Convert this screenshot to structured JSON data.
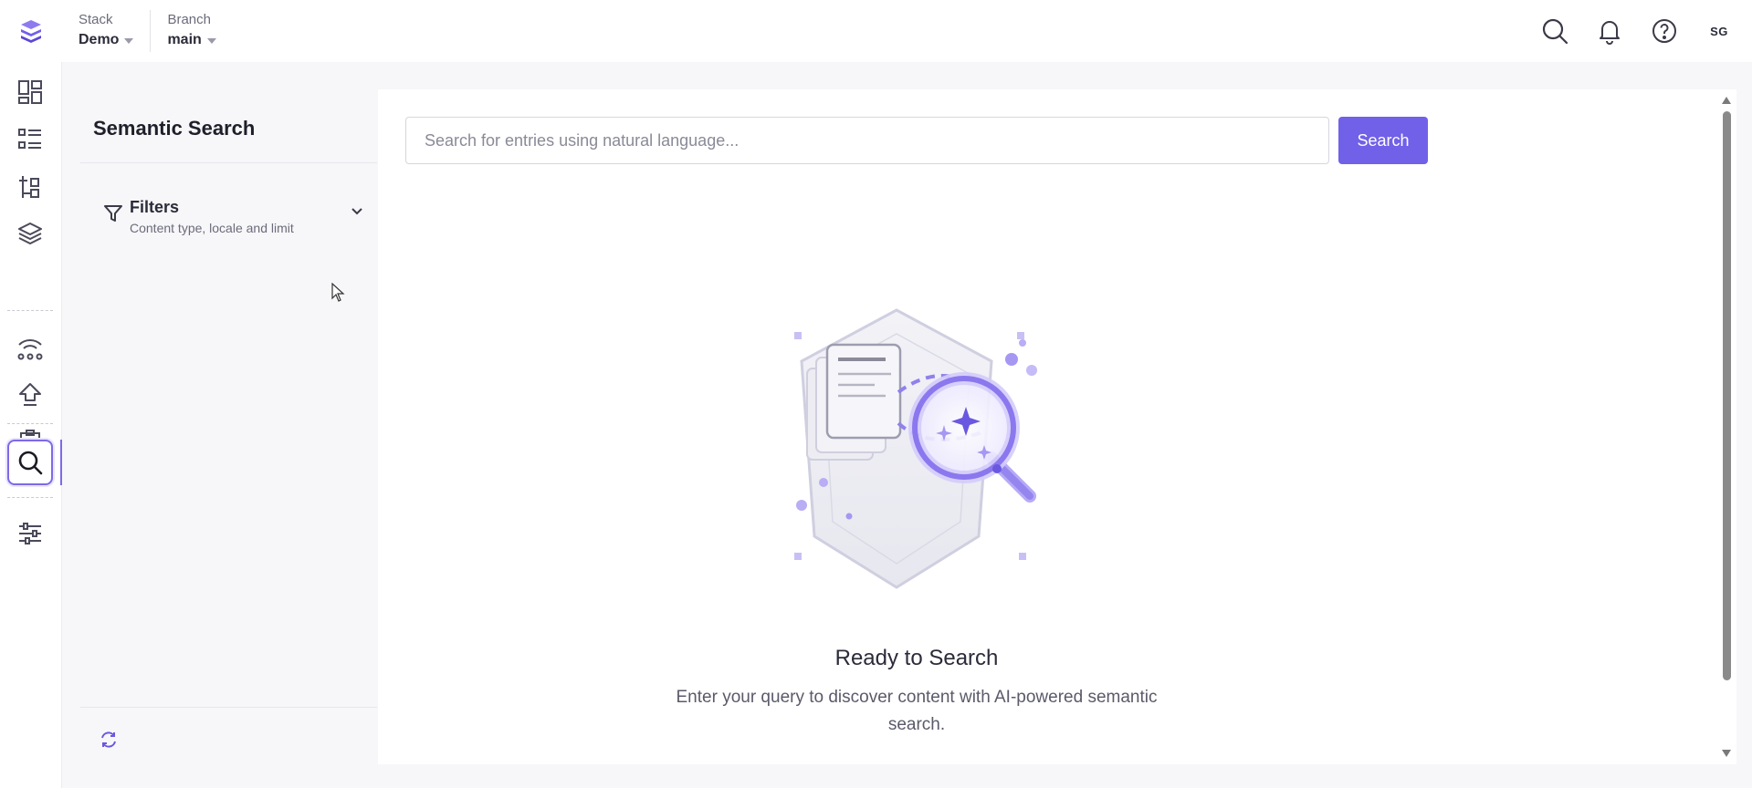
{
  "header": {
    "stack_label": "Stack",
    "stack_value": "Demo",
    "branch_label": "Branch",
    "branch_value": "main",
    "avatar_initials": "SG",
    "icons": [
      "search-icon",
      "bell-icon",
      "help-icon"
    ]
  },
  "rail": {
    "items": [
      "dashboard-icon",
      "entries-icon",
      "content-models-icon",
      "assets-layers-icon",
      "releases-icon",
      "publish-queue-icon",
      "workflow-tasks-icon",
      "semantic-search-icon",
      "settings-sliders-icon"
    ],
    "active": "semantic-search-icon",
    "accent": "#7c6ae8"
  },
  "panel": {
    "title": "Semantic Search",
    "filters_label": "Filters",
    "filters_sub": "Content type, locale and limit"
  },
  "main": {
    "search_placeholder": "Search for entries using natural language...",
    "search_value": "",
    "search_button": "Search",
    "empty_title": "Ready to Search",
    "empty_desc": "Enter your query to discover content with AI-powered semantic search."
  },
  "colors": {
    "brand": "#7160e8",
    "background": "#f7f7f9"
  }
}
